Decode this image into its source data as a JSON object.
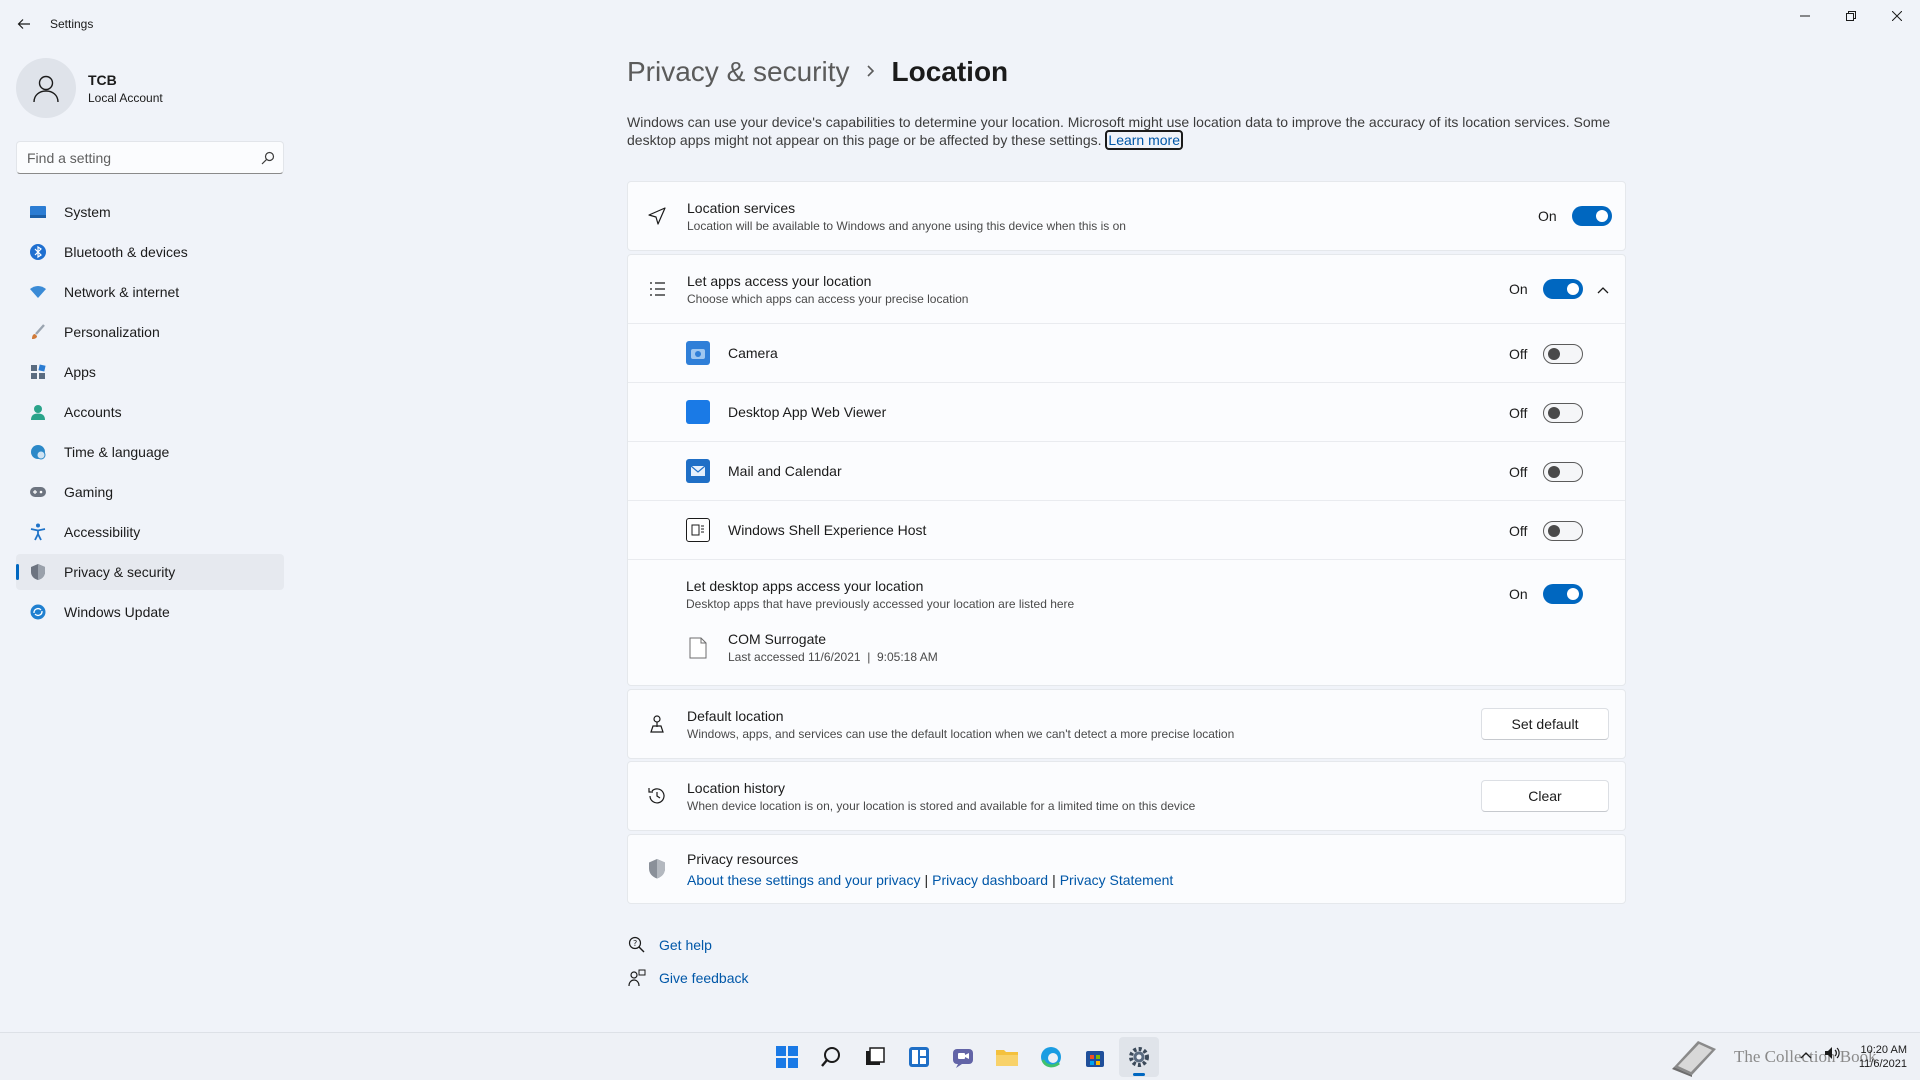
{
  "window": {
    "title": "Settings"
  },
  "profile": {
    "name": "TCB",
    "account_type": "Local Account"
  },
  "search": {
    "placeholder": "Find a setting"
  },
  "nav": {
    "items": [
      {
        "label": "System",
        "icon": "system-icon",
        "color": "#2b7cd3"
      },
      {
        "label": "Bluetooth & devices",
        "icon": "bluetooth-icon",
        "color": "#1f6fd0"
      },
      {
        "label": "Network & internet",
        "icon": "wifi-icon",
        "color": "#3a8ad6"
      },
      {
        "label": "Personalization",
        "icon": "brush-icon",
        "color": "#d07a3a"
      },
      {
        "label": "Apps",
        "icon": "apps-icon",
        "color": "#5a6b80"
      },
      {
        "label": "Accounts",
        "icon": "person-icon",
        "color": "#2aa38a"
      },
      {
        "label": "Time & language",
        "icon": "globe-clock-icon",
        "color": "#2b88c8"
      },
      {
        "label": "Gaming",
        "icon": "gamepad-icon",
        "color": "#6d7480"
      },
      {
        "label": "Accessibility",
        "icon": "accessibility-icon",
        "color": "#1f73c8"
      },
      {
        "label": "Privacy & security",
        "icon": "shield-icon",
        "color": "#6d7480"
      },
      {
        "label": "Windows Update",
        "icon": "update-icon",
        "color": "#1f7fd0"
      }
    ],
    "active_index": 9
  },
  "page": {
    "breadcrumb_parent": "Privacy & security",
    "breadcrumb_current": "Location",
    "description": "Windows can use your device's capabilities to determine your location. Microsoft might use location data to improve the accuracy of its location services. Some desktop apps might not appear on this page or be affected by these settings.",
    "learn_more": "Learn more"
  },
  "location_services": {
    "title": "Location services",
    "subtitle": "Location will be available to Windows and anyone using this device when this is on",
    "state_label": "On",
    "enabled": true
  },
  "app_access": {
    "title": "Let apps access your location",
    "subtitle": "Choose which apps can access your precise location",
    "state_label": "On",
    "enabled": true,
    "apps": [
      {
        "name": "Camera",
        "state_label": "Off",
        "icon": "camera-icon",
        "color": "#2f7fd8"
      },
      {
        "name": "Desktop App Web Viewer",
        "state_label": "Off",
        "icon": "app-tile-icon",
        "color": "#1a7ae6"
      },
      {
        "name": "Mail and Calendar",
        "state_label": "Off",
        "icon": "mail-icon",
        "color": "#1f6fc6"
      },
      {
        "name": "Windows Shell Experience Host",
        "state_label": "Off",
        "icon": "shell-host-icon",
        "color": "#1b1b1b"
      }
    ],
    "desktop": {
      "title": "Let desktop apps access your location",
      "subtitle": "Desktop apps that have previously accessed your location are listed here",
      "state_label": "On",
      "enabled": true,
      "app_name": "COM Surrogate",
      "app_detail": "Last accessed 11/6/2021  |  9:05:18 AM"
    }
  },
  "default_location": {
    "title": "Default location",
    "subtitle": "Windows, apps, and services can use the default location when we can't detect a more precise location",
    "button": "Set default"
  },
  "location_history": {
    "title": "Location history",
    "subtitle": "When device location is on, your location is stored and available for a limited time on this device",
    "button": "Clear"
  },
  "privacy_resources": {
    "title": "Privacy resources",
    "link1": "About these settings and your privacy",
    "link2": "Privacy dashboard",
    "link3": "Privacy Statement",
    "separator": "|"
  },
  "help": {
    "get_help": "Get help",
    "give_feedback": "Give feedback"
  },
  "taskbar": {
    "watermark": "The Collection Book",
    "time": "10:20 AM",
    "date": "11/6/2021"
  },
  "colors": {
    "accent": "#0067c0",
    "link": "#0057a8",
    "background": "#f0f3f9",
    "card": "#fbfcfe"
  }
}
